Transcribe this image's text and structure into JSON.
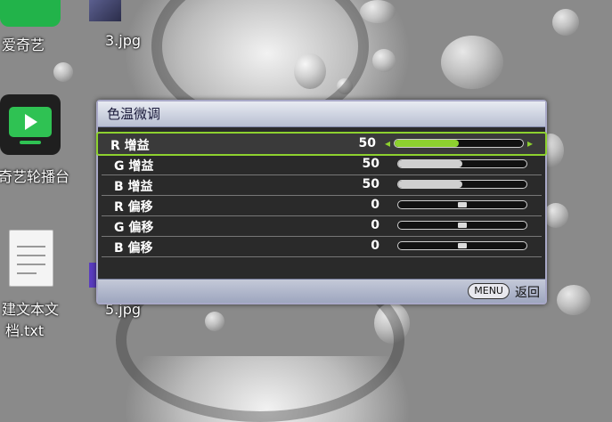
{
  "desktop": {
    "icons": [
      {
        "label": "爱奇艺",
        "name": "iqiyi-app-icon"
      },
      {
        "label": "3.jpg",
        "name": "image-file-icon"
      },
      {
        "label": "奇艺轮播台",
        "name": "iqiyi-player-icon"
      },
      {
        "label": "5.jpg",
        "name": "image-file-icon"
      },
      {
        "label": "建文本文",
        "name": "text-file-icon"
      },
      {
        "label": "档.txt",
        "name": "text-file-icon"
      }
    ]
  },
  "osd": {
    "title": "色温微调",
    "rows": [
      {
        "label": "R 增益",
        "value": "50",
        "fill": 0.5,
        "kind": "gain",
        "selected": true
      },
      {
        "label": "G 增益",
        "value": "50",
        "fill": 0.5,
        "kind": "gain",
        "selected": false
      },
      {
        "label": "B 增益",
        "value": "50",
        "fill": 0.5,
        "kind": "gain",
        "selected": false
      },
      {
        "label": "R 偏移",
        "value": "0",
        "fill": 0.5,
        "kind": "offset",
        "selected": false
      },
      {
        "label": "G 偏移",
        "value": "0",
        "fill": 0.5,
        "kind": "offset",
        "selected": false
      },
      {
        "label": "B 偏移",
        "value": "0",
        "fill": 0.5,
        "kind": "offset",
        "selected": false
      }
    ],
    "footer": {
      "menu_button": "MENU",
      "back_label": "返回"
    },
    "colors": {
      "accent": "#8dd12f",
      "title_bg": "#c8cedd",
      "panel_bg": "#2a2a2a"
    }
  }
}
